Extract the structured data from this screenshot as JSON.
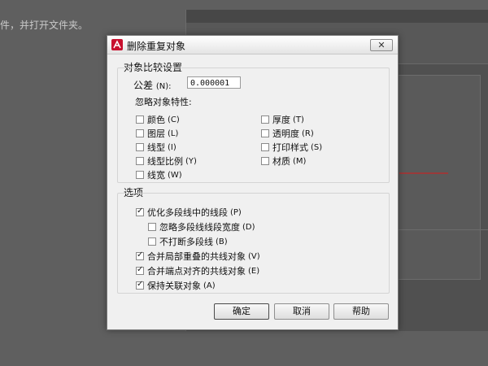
{
  "background": {
    "caption": "件，并打开文件夹。"
  },
  "dialog": {
    "title": "删除重复对象",
    "close_icon": "close-icon",
    "app_icon": "autocad-logo-icon",
    "compare": {
      "group_title": "对象比较设置",
      "tolerance_label": "公差",
      "tolerance_key": "(N):",
      "tolerance_value": "0.000001",
      "ignore_label": "忽略对象特性:",
      "properties_left": [
        {
          "label": "颜色",
          "key": "(C)",
          "checked": false
        },
        {
          "label": "图层",
          "key": "(L)",
          "checked": false
        },
        {
          "label": "线型",
          "key": "(I)",
          "checked": false
        },
        {
          "label": "线型比例",
          "key": "(Y)",
          "checked": false
        },
        {
          "label": "线宽",
          "key": "(W)",
          "checked": false
        }
      ],
      "properties_right": [
        {
          "label": "厚度",
          "key": "(T)",
          "checked": false
        },
        {
          "label": "透明度",
          "key": "(R)",
          "checked": false
        },
        {
          "label": "打印样式",
          "key": "(S)",
          "checked": false
        },
        {
          "label": "材质",
          "key": "(M)",
          "checked": false
        }
      ]
    },
    "options": {
      "group_title": "选项",
      "items": [
        {
          "label": "优化多段线中的线段",
          "key": "(P)",
          "checked": true,
          "indent": false
        },
        {
          "label": "忽略多段线线段宽度",
          "key": "(D)",
          "checked": false,
          "indent": true
        },
        {
          "label": "不打断多段线",
          "key": "(B)",
          "checked": false,
          "indent": true
        },
        {
          "label": "合并局部重叠的共线对象",
          "key": "(V)",
          "checked": true,
          "indent": false
        },
        {
          "label": "合并端点对齐的共线对象",
          "key": "(E)",
          "checked": true,
          "indent": false
        },
        {
          "label": "保持关联对象",
          "key": "(A)",
          "checked": true,
          "indent": false
        }
      ]
    },
    "buttons": {
      "ok": "确定",
      "cancel": "取消",
      "help": "帮助"
    }
  },
  "colors": {
    "logo_red": "#c8102e",
    "dialog_bg": "#f0f0f0"
  }
}
